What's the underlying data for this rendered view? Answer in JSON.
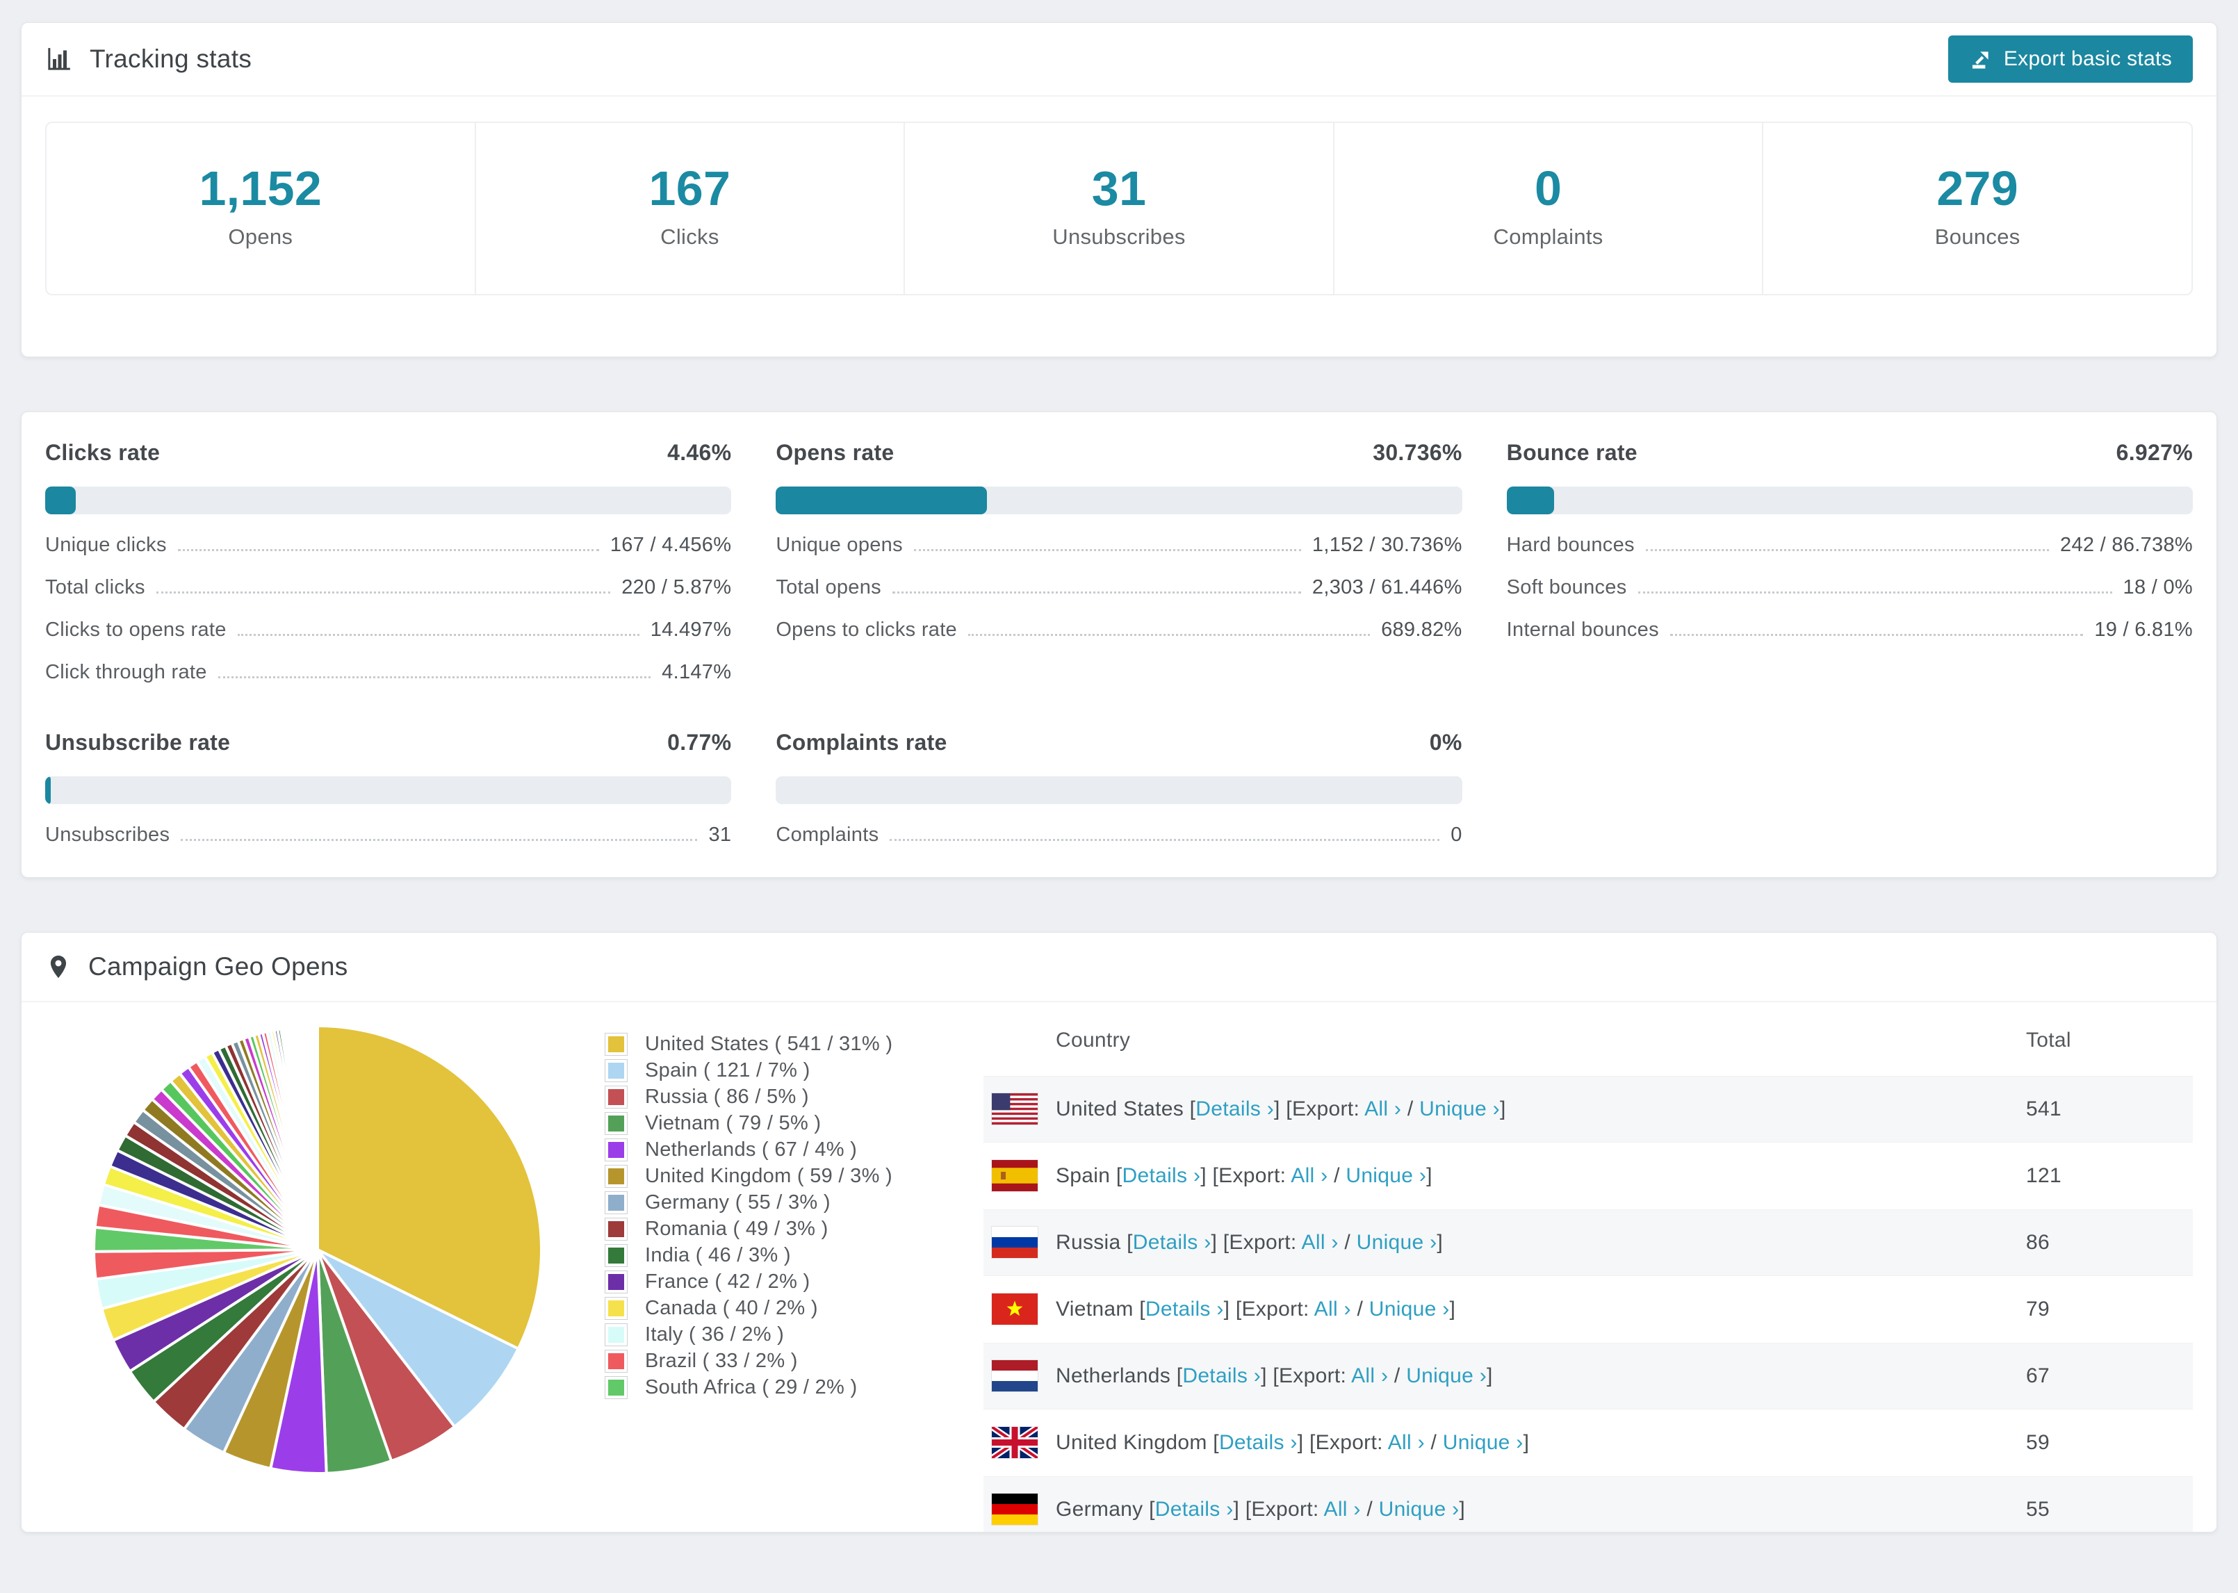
{
  "tracking": {
    "title": "Tracking stats",
    "export_button": "Export basic stats",
    "summary": [
      {
        "value": "1,152",
        "label": "Opens"
      },
      {
        "value": "167",
        "label": "Clicks"
      },
      {
        "value": "31",
        "label": "Unsubscribes"
      },
      {
        "value": "0",
        "label": "Complaints"
      },
      {
        "value": "279",
        "label": "Bounces"
      }
    ]
  },
  "rates": [
    {
      "title": "Clicks rate",
      "value_label": "4.46%",
      "percent": 4.46,
      "rows": [
        {
          "label": "Unique clicks",
          "value": "167 / 4.456%"
        },
        {
          "label": "Total clicks",
          "value": "220 / 5.87%"
        },
        {
          "label": "Clicks to opens rate",
          "value": "14.497%"
        },
        {
          "label": "Click through rate",
          "value": "4.147%"
        }
      ]
    },
    {
      "title": "Opens rate",
      "value_label": "30.736%",
      "percent": 30.736,
      "rows": [
        {
          "label": "Unique opens",
          "value": "1,152 / 30.736%"
        },
        {
          "label": "Total opens",
          "value": "2,303 / 61.446%"
        },
        {
          "label": "Opens to clicks rate",
          "value": "689.82%"
        }
      ]
    },
    {
      "title": "Bounce rate",
      "value_label": "6.927%",
      "percent": 6.927,
      "rows": [
        {
          "label": "Hard bounces",
          "value": "242 / 86.738%"
        },
        {
          "label": "Soft bounces",
          "value": "18 / 0%"
        },
        {
          "label": "Internal bounces",
          "value": "19 / 6.81%"
        }
      ]
    },
    {
      "title": "Unsubscribe rate",
      "value_label": "0.77%",
      "percent": 0.77,
      "rows": [
        {
          "label": "Unsubscribes",
          "value": "31"
        }
      ]
    },
    {
      "title": "Complaints rate",
      "value_label": "0%",
      "percent": 0,
      "rows": [
        {
          "label": "Complaints",
          "value": "0"
        }
      ]
    }
  ],
  "geo": {
    "title": "Campaign Geo Opens",
    "table": {
      "headers": [
        "Country",
        "Total"
      ],
      "link_labels": {
        "details": "Details ›",
        "export_prefix": "Export:",
        "all": "All ›",
        "unique": "Unique ›"
      },
      "rows": [
        {
          "flag": "us",
          "country": "United States",
          "total": "541"
        },
        {
          "flag": "es",
          "country": "Spain",
          "total": "121"
        },
        {
          "flag": "ru",
          "country": "Russia",
          "total": "86"
        },
        {
          "flag": "vn",
          "country": "Vietnam",
          "total": "79"
        },
        {
          "flag": "nl",
          "country": "Netherlands",
          "total": "67"
        },
        {
          "flag": "gb",
          "country": "United Kingdom",
          "total": "59"
        },
        {
          "flag": "de",
          "country": "Germany",
          "total": "55"
        }
      ]
    },
    "chart_data": {
      "type": "pie",
      "title": "Campaign Geo Opens",
      "legend_position": "right",
      "start_angle_deg": -90,
      "direction": "clockwise",
      "series": [
        {
          "name": "United States",
          "value": 541,
          "pct": "31%",
          "color": "#E3C23C",
          "legend_label": "United States ( 541 / 31% )"
        },
        {
          "name": "Spain",
          "value": 121,
          "pct": "7%",
          "color": "#AED6F2",
          "legend_label": "Spain ( 121 / 7% )"
        },
        {
          "name": "Russia",
          "value": 86,
          "pct": "5%",
          "color": "#C25055",
          "legend_label": "Russia ( 86 / 5% )"
        },
        {
          "name": "Vietnam",
          "value": 79,
          "pct": "5%",
          "color": "#53A158",
          "legend_label": "Vietnam ( 79 / 5% )"
        },
        {
          "name": "Netherlands",
          "value": 67,
          "pct": "4%",
          "color": "#9B3EEA",
          "legend_label": "Netherlands ( 67 / 4% )"
        },
        {
          "name": "United Kingdom",
          "value": 59,
          "pct": "3%",
          "color": "#B6962C",
          "legend_label": "United Kingdom ( 59 / 3% )"
        },
        {
          "name": "Germany",
          "value": 55,
          "pct": "3%",
          "color": "#8FAECC",
          "legend_label": "Germany ( 55 / 3% )"
        },
        {
          "name": "Romania",
          "value": 49,
          "pct": "3%",
          "color": "#9E3A3A",
          "legend_label": "Romania ( 49 / 3% )"
        },
        {
          "name": "India",
          "value": 46,
          "pct": "3%",
          "color": "#337A3B",
          "legend_label": "India ( 46 / 3% )"
        },
        {
          "name": "France",
          "value": 42,
          "pct": "2%",
          "color": "#6D2FA8",
          "legend_label": "France ( 42 / 2% )"
        },
        {
          "name": "Canada",
          "value": 40,
          "pct": "2%",
          "color": "#F5E14B",
          "legend_label": "Canada ( 40 / 2% )"
        },
        {
          "name": "Italy",
          "value": 36,
          "pct": "2%",
          "color": "#D7FBF9",
          "legend_label": "Italy ( 36 / 2% )"
        },
        {
          "name": "Brazil",
          "value": 33,
          "pct": "2%",
          "color": "#EF5A5F",
          "legend_label": "Brazil ( 33 / 2% )"
        },
        {
          "name": "South Africa",
          "value": 29,
          "pct": "2%",
          "color": "#62C968",
          "legend_label": "South Africa ( 29 / 2% )"
        }
      ],
      "tail_values_estimated": [
        27,
        25,
        23,
        21,
        20,
        19,
        18,
        17,
        16,
        15,
        14,
        13,
        12,
        11,
        10,
        9,
        9,
        8,
        8,
        7,
        7,
        6,
        6,
        5,
        5,
        5,
        4,
        4,
        4,
        3,
        3,
        3,
        3,
        2,
        2,
        2,
        2,
        2,
        2,
        2,
        1,
        1,
        1,
        1,
        1,
        1,
        1,
        1,
        1,
        1,
        1,
        1,
        1,
        1,
        1,
        1,
        1,
        1
      ],
      "tail_palette": [
        "#EF5A5F",
        "#E4FBFB",
        "#F4EF49",
        "#3B2E8F",
        "#2F6B33",
        "#8F3333",
        "#77919F",
        "#8F7A22",
        "#C93ACD",
        "#57C75D",
        "#E3C23C",
        "#9B3EEA"
      ]
    }
  }
}
